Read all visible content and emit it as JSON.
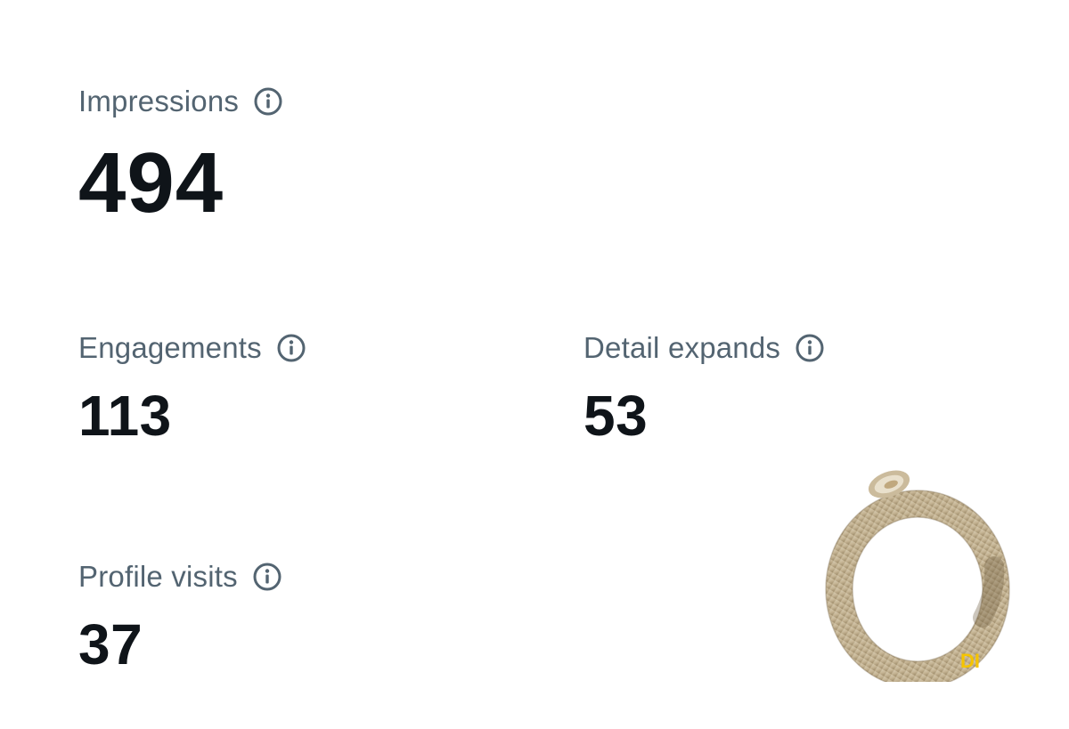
{
  "metrics": [
    {
      "label": "Impressions",
      "value": "494"
    },
    {
      "label": "Engagements",
      "value": "113"
    },
    {
      "label": "Detail expands",
      "value": "53"
    },
    {
      "label": "Profile visits",
      "value": "37"
    }
  ],
  "icons": {
    "info": "info-circle-icon",
    "sticker": "ring-sticker"
  },
  "colors": {
    "label": "#536471",
    "value": "#0f1419",
    "background": "#ffffff",
    "sticker_ring": "#c9b99a",
    "sticker_text": "#f5c400"
  }
}
